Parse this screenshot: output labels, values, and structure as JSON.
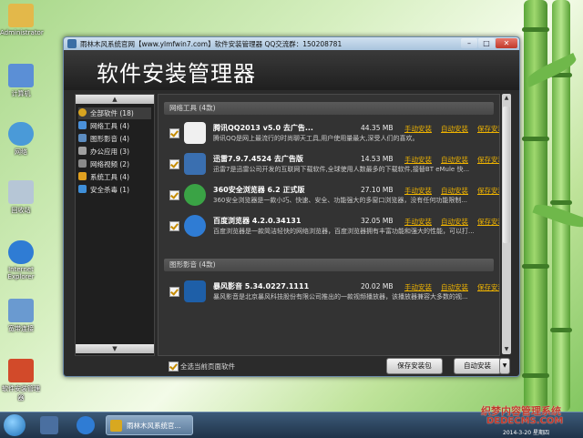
{
  "desktop": {
    "icons": [
      {
        "label": "Administrator",
        "color": "#e3b84a"
      },
      {
        "label": "计算机",
        "color": "#5b8fd6"
      },
      {
        "label": "网络",
        "color": "#4a9ad8"
      },
      {
        "label": "回收站",
        "color": "#b6c6d6"
      },
      {
        "label": "Internet Explorer",
        "color": "#2f7cd4"
      },
      {
        "label": "宽带连接",
        "color": "#6a9ad0"
      },
      {
        "label": "软件安装管理器",
        "color": "#d24a2a"
      }
    ]
  },
  "window": {
    "title": "雨林木风系统官网【www.ylmfwin7.com】软件安装管理器    QQ交流群：150208781",
    "header": "软件安装管理器",
    "minimize": "–",
    "maximize": "□",
    "close": "✕"
  },
  "sidebar": {
    "up": "▲",
    "down": "▼",
    "items": [
      {
        "label": "全部软件 (18)",
        "color": "#d9a520"
      },
      {
        "label": "网络工具 (4)",
        "color": "#4a90d9"
      },
      {
        "label": "图形影音 (4)",
        "color": "#5c8cc0"
      },
      {
        "label": "办公应用 (3)",
        "color": "#a0a0a0"
      },
      {
        "label": "网络视频 (2)",
        "color": "#8a8a8a"
      },
      {
        "label": "系统工具 (4)",
        "color": "#e0a020"
      },
      {
        "label": "安全杀毒 (1)",
        "color": "#3f8fd9"
      }
    ]
  },
  "groups": [
    {
      "header": "网络工具 (4款)"
    },
    {
      "header": "图形影音 (4款)"
    }
  ],
  "apps": [
    {
      "name": "腾讯QQ2013 v5.0 去广告...",
      "size": "44.35 MB",
      "desc": "腾讯QQ是网上最流行的时尚聊天工具,用户使用量最大,深受人们的喜欢。",
      "color": "#222"
    },
    {
      "name": "迅雷7.9.7.4524 去广告版",
      "size": "14.53 MB",
      "desc": "迅雷7是迅雷公司开发的互联网下载软件,全球使用人数最多的下载软件,接替BT eMule 快...",
      "color": "#3a6fb0"
    },
    {
      "name": "360安全浏览器 6.2 正式版",
      "size": "27.10 MB",
      "desc": "360安全浏览器是一款小巧、快速、安全、功能强大的多窗口浏览器，没有任何功能限制...",
      "color": "#3aa345"
    },
    {
      "name": "百度浏览器 4.2.0.34131",
      "size": "32.05 MB",
      "desc": "百度浏览器是一款简洁轻快的网络浏览器，百度浏览器拥有丰富功能和强大的性能，可以打...",
      "color": "#2f7cd4"
    },
    {
      "name": "暴风影音 5.34.0227.1111",
      "size": "20.02 MB",
      "desc": "暴风影音是北京暴风科技股份有限公司推出的一款视频播放器，该播放器兼容大多数的视...",
      "color": "#1e5fa8"
    }
  ],
  "actions": {
    "manual": "手动安装",
    "auto": "自动安装",
    "save": "保存安装包"
  },
  "footer": {
    "select_all": "全选当前页面软件",
    "save_button": "保存安装包",
    "auto_button": "自动安装",
    "drop": "▼"
  },
  "taskbar": {
    "task": "雨林木风系统官...",
    "date": "2014-3-20 星期四"
  },
  "watermark": {
    "line1": "织梦内容管理系统",
    "line2": "DEDECMS.COM"
  }
}
